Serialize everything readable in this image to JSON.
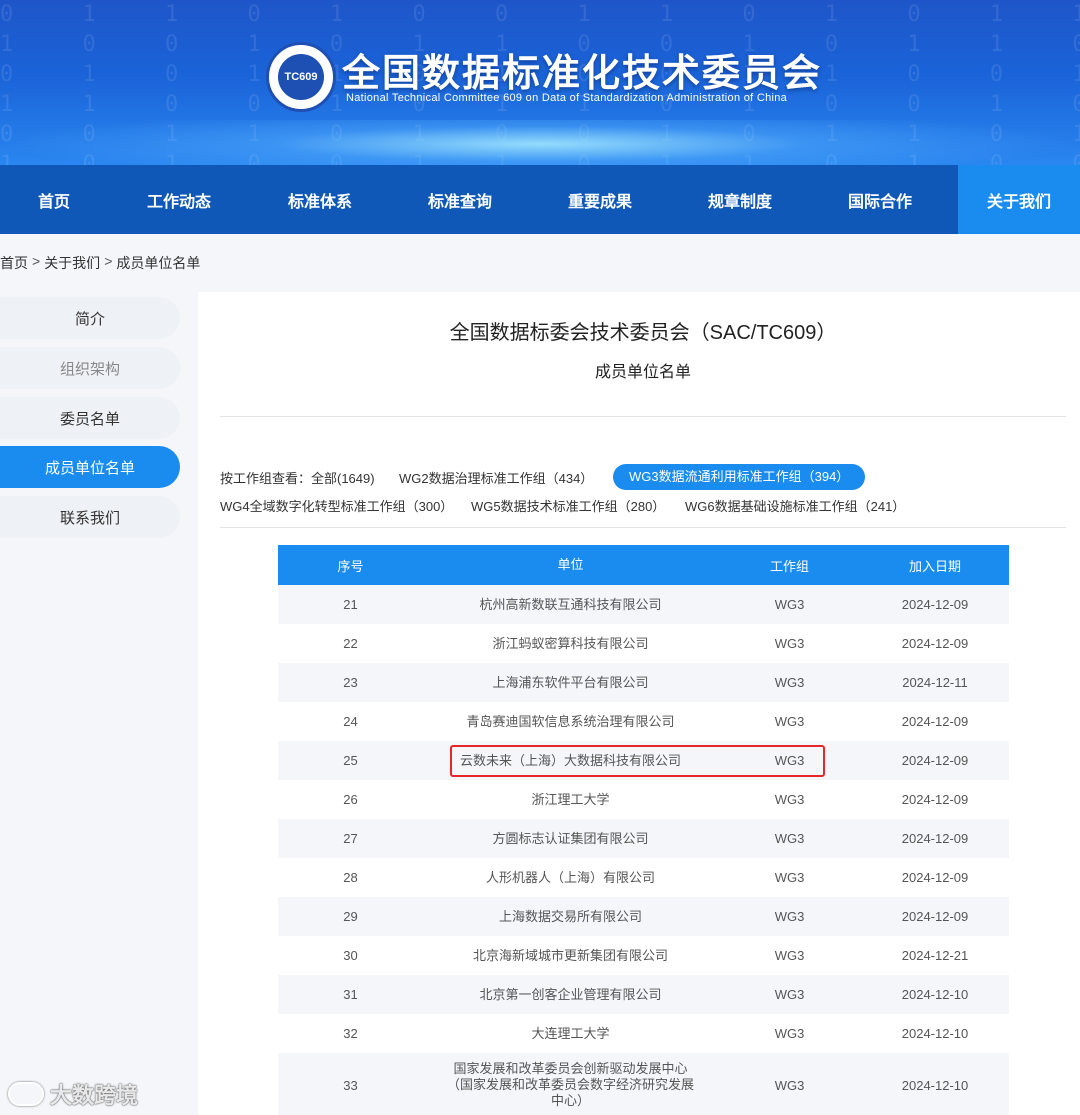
{
  "header": {
    "logo_text": "TC609",
    "title": "全国数据标准化技术委员会",
    "subtitle": "National Technical Committee 609 on Data of Standardization Administration of China"
  },
  "nav": {
    "items": [
      "首页",
      "工作动态",
      "标准体系",
      "标准查询",
      "重要成果",
      "规章制度",
      "国际合作",
      "关于我们"
    ],
    "active": "关于我们"
  },
  "breadcrumb": [
    "首页",
    "关于我们",
    "成员单位名单"
  ],
  "sidebar": {
    "items": [
      "简介",
      "组织架构",
      "委员名单",
      "成员单位名单",
      "联系我们"
    ],
    "active": "成员单位名单"
  },
  "main": {
    "title": "全国数据标委会技术委员会（SAC/TC609）",
    "subtitle": "成员单位名单",
    "filter_label": "按工作组查看：",
    "filters": [
      "全部(1649)",
      "WG2数据治理标准工作组（434）",
      "WG3数据流通利用标准工作组（394）",
      "WG4全域数字化转型标准工作组（300）",
      "WG5数据技术标准工作组（280）",
      "WG6数据基础设施标准工作组（241）"
    ],
    "active_filter": "WG3数据流通利用标准工作组（394）"
  },
  "table": {
    "headers": [
      "序号",
      "单位",
      "工作组",
      "加入日期"
    ],
    "rows": [
      [
        "21",
        "杭州高新数联互通科技有限公司",
        "WG3",
        "2024-12-09"
      ],
      [
        "22",
        "浙江蚂蚁密算科技有限公司",
        "WG3",
        "2024-12-09"
      ],
      [
        "23",
        "上海浦东软件平台有限公司",
        "WG3",
        "2024-12-11"
      ],
      [
        "24",
        "青岛赛迪国软信息系统治理有限公司",
        "WG3",
        "2024-12-09"
      ],
      [
        "25",
        "云数未来（上海）大数据科技有限公司",
        "WG3",
        "2024-12-09"
      ],
      [
        "26",
        "浙江理工大学",
        "WG3",
        "2024-12-09"
      ],
      [
        "27",
        "方圆标志认证集团有限公司",
        "WG3",
        "2024-12-09"
      ],
      [
        "28",
        "人形机器人（上海）有限公司",
        "WG3",
        "2024-12-09"
      ],
      [
        "29",
        "上海数据交易所有限公司",
        "WG3",
        "2024-12-09"
      ],
      [
        "30",
        "北京海新域城市更新集团有限公司",
        "WG3",
        "2024-12-21"
      ],
      [
        "31",
        "北京第一创客企业管理有限公司",
        "WG3",
        "2024-12-10"
      ],
      [
        "32",
        "大连理工大学",
        "WG3",
        "2024-12-10"
      ],
      [
        "33",
        "国家发展和改革委员会创新驱动发展中心（国家发展和改革委员会数字经济研究发展中心）",
        "WG3",
        "2024-12-10"
      ]
    ],
    "highlighted_row": "25"
  },
  "watermark": "大数跨境",
  "colors": {
    "nav_bg": "#0f58b8",
    "accent": "#1a8cf0",
    "highlight_border": "#e5262b"
  }
}
